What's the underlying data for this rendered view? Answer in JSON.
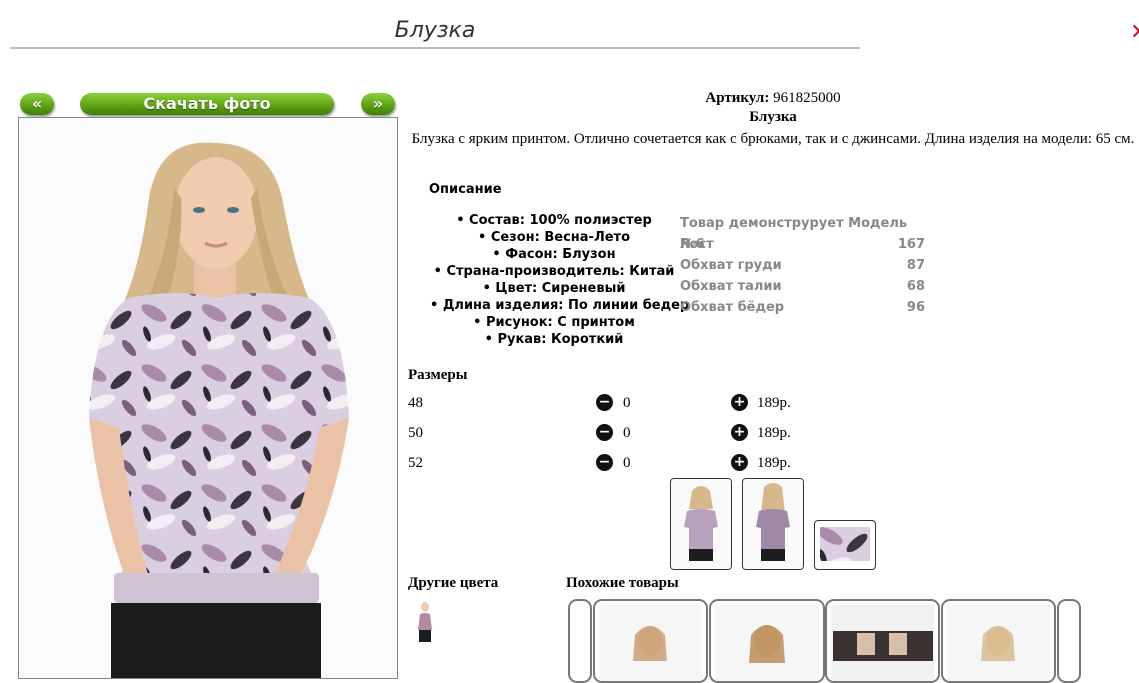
{
  "page": {
    "title": "Блузка",
    "close_glyph": "✕"
  },
  "nav": {
    "prev_label": "«",
    "next_label": "»",
    "download_label": "Скачать фото"
  },
  "product": {
    "article_label": "Артикул:",
    "article_value": "961825000",
    "name": "Блузка",
    "description": "Блузка с ярким принтом. Отлично сочетается как с брюками, так и с джинсами. Длина изделия на модели: 65 см."
  },
  "description_heading": "Описание",
  "features": [
    "Состав: 100% полиэстер",
    "Сезон: Весна-Лето",
    "Фасон: Блузон",
    "Страна-производитель: Китай",
    "Цвет: Сиреневый",
    "Длина изделия: По линии бедер",
    "Рисунок: С принтом",
    "Рукав: Короткий"
  ],
  "model": {
    "heading": "Товар демонструрует Модель №6",
    "rows": [
      {
        "label": "Рост",
        "value": "167"
      },
      {
        "label": "Обхват груди",
        "value": "87"
      },
      {
        "label": "Обхват талии",
        "value": "68"
      },
      {
        "label": "Обхват бёдер",
        "value": "96"
      }
    ]
  },
  "sizes": {
    "heading": "Размеры",
    "rows": [
      {
        "size": "48",
        "qty": "0",
        "price": "189р."
      },
      {
        "size": "50",
        "qty": "0",
        "price": "189р."
      },
      {
        "size": "52",
        "qty": "0",
        "price": "189р."
      }
    ],
    "minus_glyph": "−",
    "plus_glyph": "+"
  },
  "other_colors_heading": "Другие цвета",
  "similar_heading": "Похожие товары",
  "colors": {
    "background": "#ffffff",
    "button_green": "#5fa512",
    "close_red": "#c8102e",
    "muted_text": "#888888"
  },
  "icons": [
    "minus-circle-icon",
    "plus-circle-icon",
    "close-icon"
  ]
}
